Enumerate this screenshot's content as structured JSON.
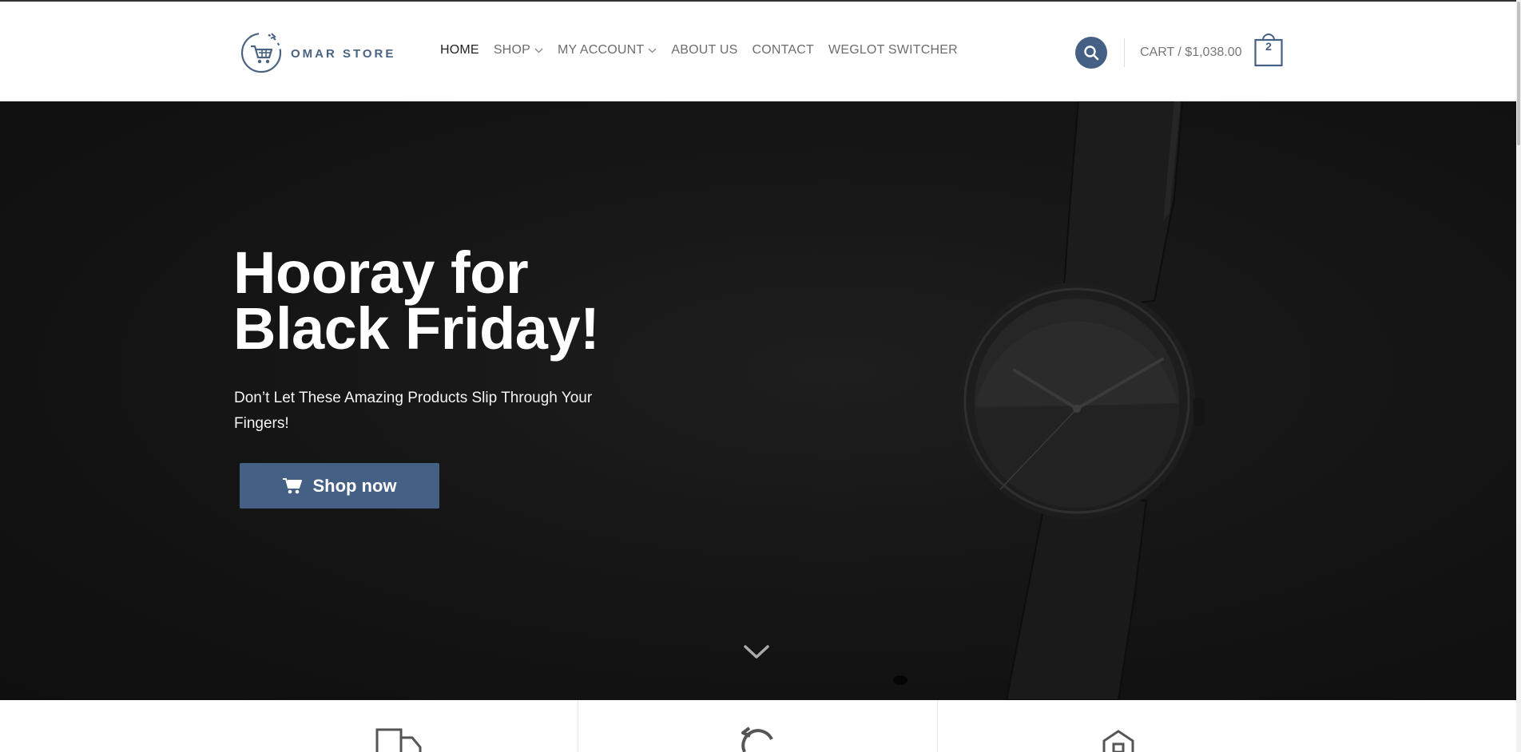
{
  "brand": {
    "name": "OMAR STORE",
    "accent": "#446084"
  },
  "nav": {
    "items": [
      {
        "label": "HOME",
        "active": true,
        "has_dropdown": false
      },
      {
        "label": "SHOP",
        "active": false,
        "has_dropdown": true
      },
      {
        "label": "MY ACCOUNT",
        "active": false,
        "has_dropdown": true
      },
      {
        "label": "ABOUT US",
        "active": false,
        "has_dropdown": false
      },
      {
        "label": "CONTACT",
        "active": false,
        "has_dropdown": false
      },
      {
        "label": "WEGLOT SWITCHER",
        "active": false,
        "has_dropdown": false
      }
    ]
  },
  "header": {
    "search_icon": "search-icon",
    "cart_label": "CART / $1,038.00",
    "cart_count": "2"
  },
  "hero": {
    "title_line1": "Hooray for",
    "title_line2": "Black Friday!",
    "subtitle": "Don’t Let These Amazing Products Slip Through Your Fingers!",
    "button_label": "Shop now",
    "button_icon": "cart-icon",
    "scroll_icon": "chevron-down-icon"
  },
  "features": {
    "icons": [
      "truck-icon",
      "refresh-icon",
      "home-icon"
    ]
  }
}
